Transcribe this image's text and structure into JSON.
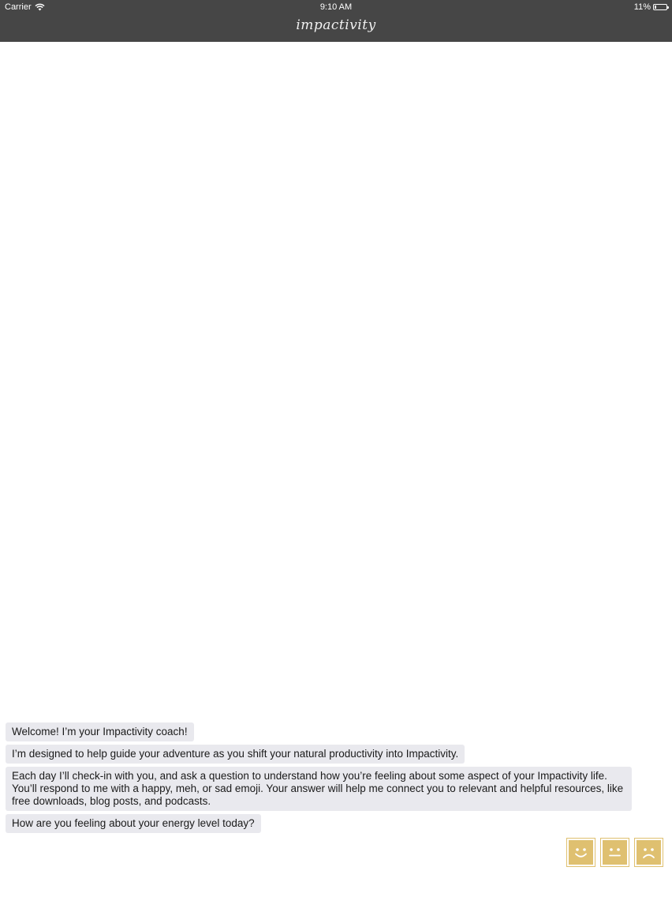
{
  "status_bar": {
    "carrier": "Carrier",
    "time": "9:10 AM",
    "battery_percent": "11%",
    "battery_level": 0.11
  },
  "header": {
    "title": "impactivity",
    "background": "#464646"
  },
  "messages": [
    {
      "text": "Welcome! I’m your Impactivity coach!"
    },
    {
      "text": "I’m designed to help guide your adventure as you shift your natural productivity into Impactivity."
    },
    {
      "text": "Each day I’ll check-in with you, and ask a question to understand how you’re feeling about some aspect of your Impactivity life. You’ll respond to me with a happy, meh, or sad emoji. Your answer will help me connect you to relevant and helpful resources, like free downloads, blog posts, and podcasts."
    },
    {
      "text": "How are you feeling about your energy level today?"
    }
  ],
  "emoji_buttons": [
    {
      "icon": "happy-face-icon"
    },
    {
      "icon": "meh-face-icon"
    },
    {
      "icon": "sad-face-icon"
    }
  ],
  "colors": {
    "accent": "#dfc070",
    "bubble": "#e9e9ee"
  }
}
